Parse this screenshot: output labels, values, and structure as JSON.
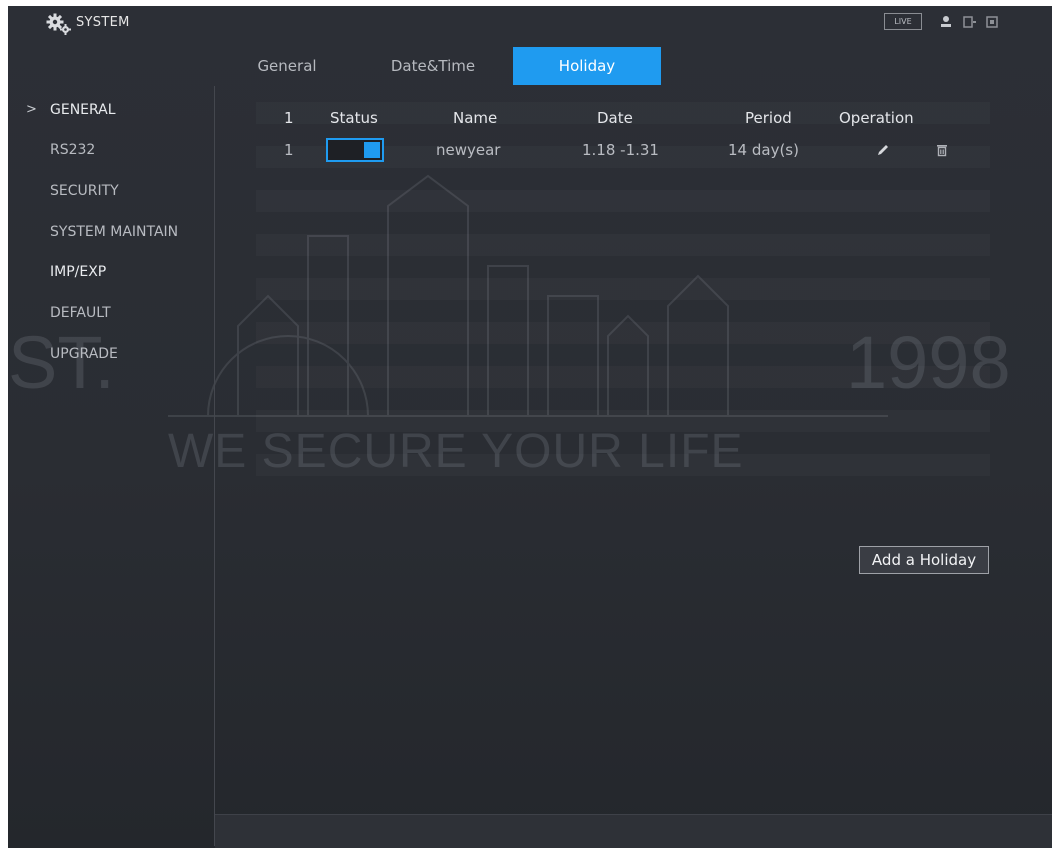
{
  "header": {
    "title": "SYSTEM",
    "live_label": "LIVE",
    "icons": [
      "gear-icon",
      "user-icon",
      "shutdown-icon",
      "exit-icon"
    ]
  },
  "sidebar": {
    "items": [
      {
        "label": "GENERAL",
        "active": true
      },
      {
        "label": "RS232"
      },
      {
        "label": "SECURITY"
      },
      {
        "label": "SYSTEM MAINTAIN"
      },
      {
        "label": "IMP/EXP"
      },
      {
        "label": "DEFAULT"
      },
      {
        "label": "UPGRADE"
      }
    ],
    "expand_glyph": ">"
  },
  "tabs": [
    {
      "label": "General"
    },
    {
      "label": "Date&Time"
    },
    {
      "label": "Holiday",
      "selected": true
    }
  ],
  "table": {
    "headers": [
      "1",
      "Status",
      "Name",
      "Date",
      "Period",
      "Operation"
    ],
    "rows": [
      {
        "index": "1",
        "status": "on",
        "name": "newyear",
        "date": "1.18 -1.31",
        "period": "14 day(s)"
      }
    ]
  },
  "watermark": {
    "line": "WE SECURE YOUR LIFE",
    "year": "1998",
    "prefix": "ST."
  },
  "buttons": {
    "add_holiday": "Add a Holiday"
  },
  "colors": {
    "accent": "#1f9bf0",
    "background": "#2a2d33",
    "text": "#b9bcc2"
  }
}
